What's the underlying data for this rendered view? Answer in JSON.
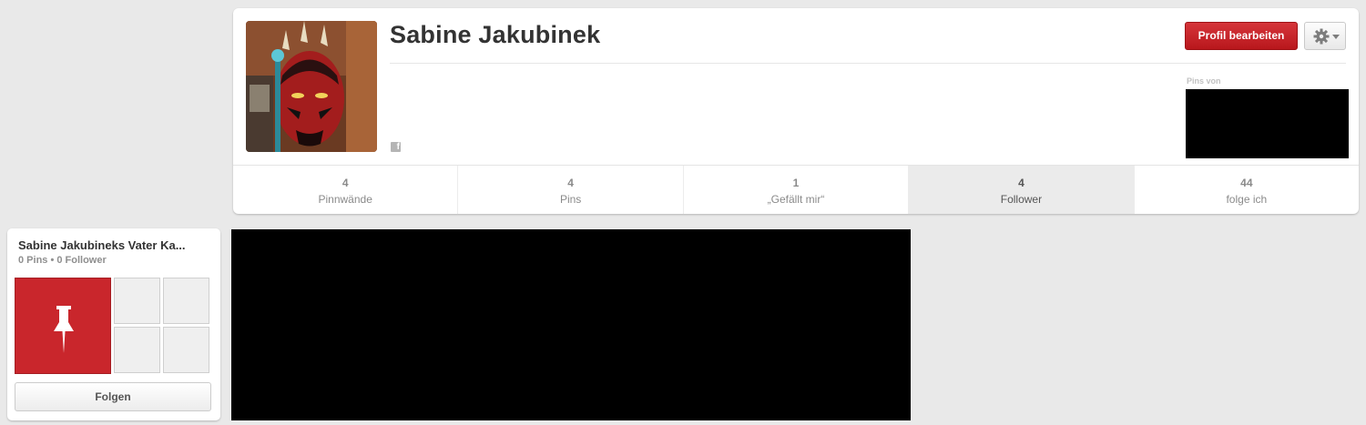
{
  "profile": {
    "name": "Sabine Jakubinek",
    "edit_button": "Profil bearbeiten",
    "settings_icon": "gear-icon",
    "facebook_icon": "facebook-icon",
    "pins_from_label": "Pins von"
  },
  "stats": [
    {
      "count": "4",
      "label": "Pinnwände"
    },
    {
      "count": "4",
      "label": "Pins"
    },
    {
      "count": "1",
      "label": "„Gefällt mir“"
    },
    {
      "count": "4",
      "label": "Follower",
      "active": true
    },
    {
      "count": "44",
      "label": "folge ich"
    }
  ],
  "board": {
    "title": "Sabine Jakubineks Vater Ka...",
    "meta": "0 Pins • 0 Follower",
    "cover_icon": "pin-icon",
    "follow_button": "Folgen"
  },
  "colors": {
    "brand_red": "#c9262c",
    "background": "#e9e9e9"
  }
}
